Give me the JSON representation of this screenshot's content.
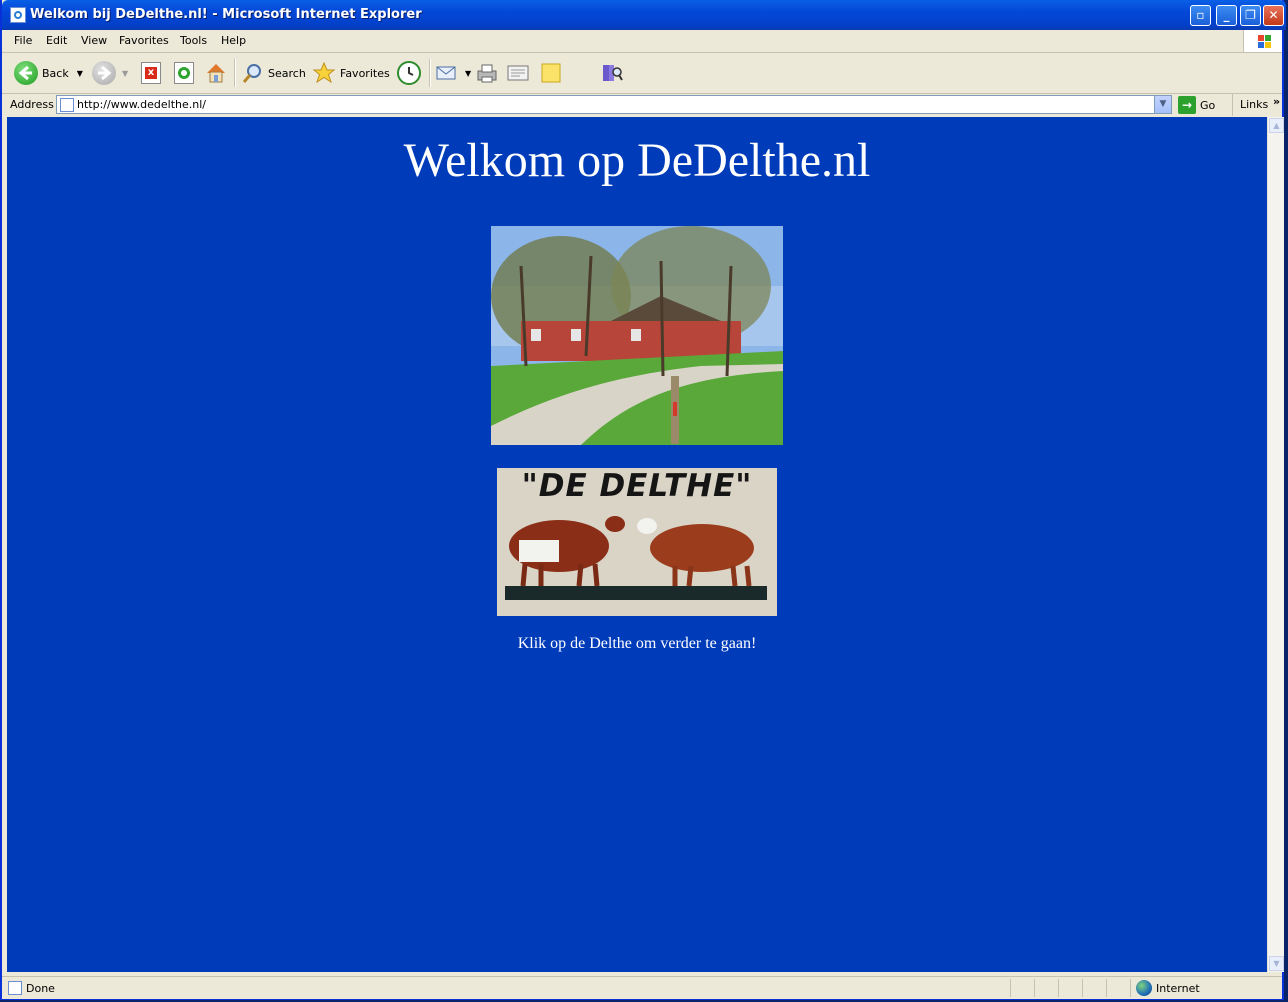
{
  "window": {
    "title": "Welkom bij DeDelthe.nl! - Microsoft Internet Explorer"
  },
  "menu": {
    "items": [
      "File",
      "Edit",
      "View",
      "Favorites",
      "Tools",
      "Help"
    ]
  },
  "toolbar": {
    "back_label": "Back",
    "search_label": "Search",
    "favorites_label": "Favorites",
    "icons": [
      "back-icon",
      "forward-icon",
      "stop-icon",
      "refresh-icon",
      "home-icon",
      "search-icon",
      "favorites-icon",
      "history-icon",
      "mail-icon",
      "print-icon",
      "edit-icon",
      "discuss-icon",
      "research-icon"
    ]
  },
  "address": {
    "label": "Address",
    "url": "http://www.dedelthe.nl/",
    "go_label": "Go",
    "links_label": "Links"
  },
  "page": {
    "heading": "Welkom op DeDelthe.nl",
    "sign_text": "\"DE DELTHE\"",
    "caption": "Klik op de Delthe om verder te gaan!"
  },
  "colors": {
    "page_background": "#003cba",
    "titlebar": "#0347d8",
    "chrome": "#ece9d8"
  },
  "status": {
    "text": "Done",
    "zone": "Internet"
  }
}
